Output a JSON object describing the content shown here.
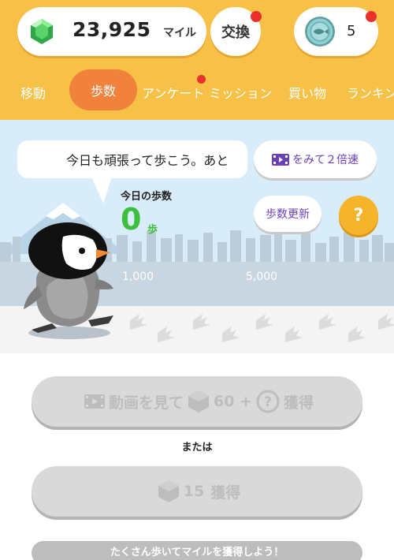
{
  "header": {
    "miles_value": "23,925",
    "miles_unit": "マイル",
    "exchange_label": "交換",
    "coin_value": "5"
  },
  "tabs": [
    {
      "label": "移動"
    },
    {
      "label": "歩数"
    },
    {
      "label": "アンケート"
    },
    {
      "label": "ミッション"
    },
    {
      "label": "買い物"
    },
    {
      "label": "ランキン"
    }
  ],
  "scene": {
    "bubble_text": "今日も頑張って歩こう。あと",
    "double_speed_label": "をみて２倍速",
    "steps_update_label": "歩数更新",
    "help_label": "?",
    "today_label": "今日の歩数",
    "steps_value": "0",
    "steps_unit": "歩",
    "milestone_1": "1,000",
    "milestone_2": "5,000"
  },
  "actions": {
    "video_button_text": "動画を見て",
    "video_button_amount": "60 +",
    "video_button_suffix": "獲得",
    "or_text": "または",
    "miles_button_amount": "15",
    "miles_button_suffix": "獲得"
  },
  "banner": {
    "text": "たくさん歩いてマイルを獲得しよう！"
  },
  "colors": {
    "header": "#f7c148",
    "active_tab": "#f0823b",
    "steps_green": "#3dbf3d",
    "accent_purple": "#6b3fb7",
    "notification": "#e9302c"
  }
}
